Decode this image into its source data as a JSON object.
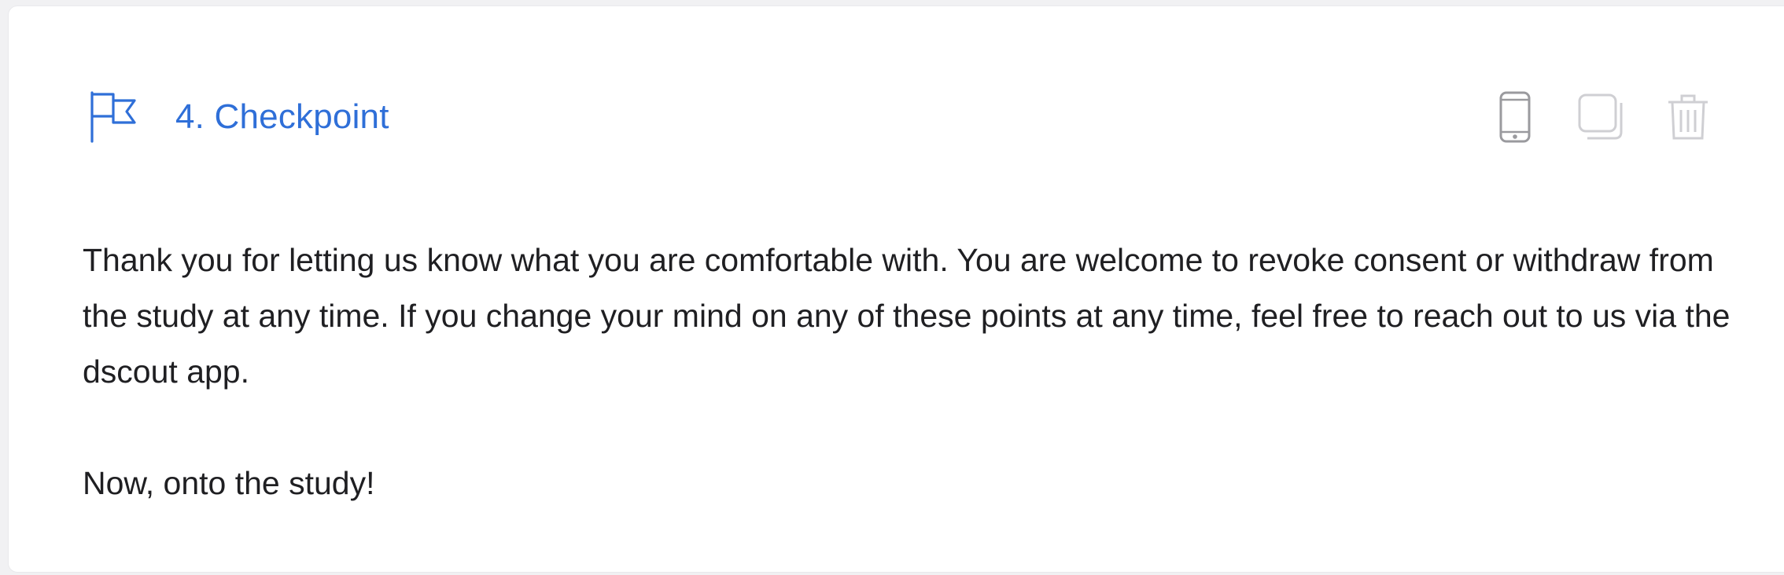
{
  "checkpoint": {
    "title": "4. Checkpoint",
    "icon": "flag-icon",
    "accent_color": "#2f6fd8"
  },
  "actions": [
    {
      "name": "mobile-preview",
      "icon": "mobile-phone-icon"
    },
    {
      "name": "duplicate",
      "icon": "duplicate-icon"
    },
    {
      "name": "delete",
      "icon": "trash-icon"
    }
  ],
  "content": {
    "paragraph_1": "Thank you for letting us know what you are comfortable with. You are welcome to revoke consent or withdraw from the study at any time. If you change your mind on any of these points at any time, feel free to reach out to us via the dscout app.",
    "paragraph_2": "Now, onto the study!"
  }
}
